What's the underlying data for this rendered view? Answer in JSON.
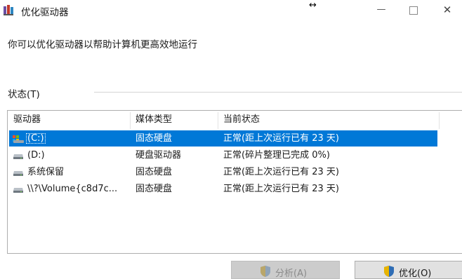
{
  "window": {
    "title": "优化驱动器",
    "resize_cursor_glyph": "↔",
    "controls": {
      "minimize": "—",
      "maximize": "",
      "close": "✕"
    }
  },
  "description": "你可以优化驱动器以帮助计算机更高效地运行",
  "status_label": "状态(T)",
  "table": {
    "columns": [
      "驱动器",
      "媒体类型",
      "当前状态"
    ],
    "rows": [
      {
        "drive": "(C:)",
        "media": "固态硬盘",
        "status": "正常(距上次运行已有 23 天)",
        "icon": "system-drive-icon",
        "selected": true
      },
      {
        "drive": "(D:)",
        "media": "硬盘驱动器",
        "status": "正常(碎片整理已完成 0%)",
        "icon": "drive-icon",
        "selected": false
      },
      {
        "drive": "系统保留",
        "media": "固态硬盘",
        "status": "正常(距上次运行已有 23 天)",
        "icon": "drive-icon",
        "selected": false
      },
      {
        "drive": "\\\\?\\Volume{c8d7c...",
        "media": "固态硬盘",
        "status": "正常(距上次运行已有 23 天)",
        "icon": "drive-icon",
        "selected": false
      }
    ]
  },
  "buttons": {
    "analyze": {
      "label": "分析(A)",
      "icon": "shield-icon",
      "enabled": false
    },
    "optimize": {
      "label": "优化(O)",
      "icon": "shield-icon",
      "enabled": true
    }
  },
  "colors": {
    "selection": "#0078d7",
    "selection_text": "#ffffff",
    "text": "#1a1a1a",
    "border": "#adadad"
  }
}
